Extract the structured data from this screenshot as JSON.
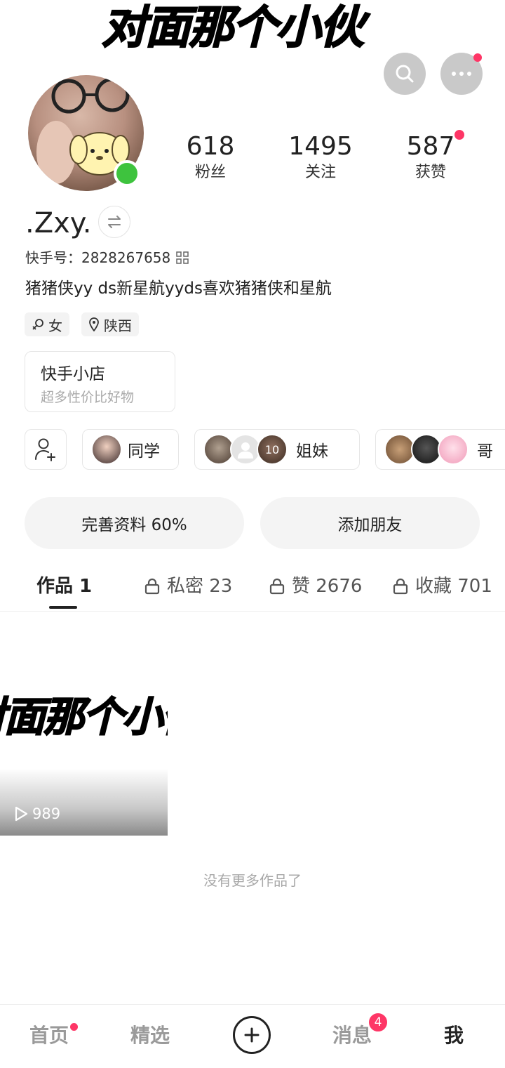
{
  "banner": {
    "title": "对面那个小伙"
  },
  "stats": [
    {
      "value": "618",
      "label": "粉丝"
    },
    {
      "value": "1495",
      "label": "关注"
    },
    {
      "value": "587",
      "label": "获赞"
    }
  ],
  "profile": {
    "username": ".Zxy.",
    "kuaishou_id": "快手号：2828267658",
    "bio": "猪猪侠yy ds新星航yyds喜欢猪猪侠和星航",
    "tags": {
      "gender": "女",
      "location": "陕西"
    }
  },
  "shop": {
    "title": "快手小店",
    "subtitle": "超多性价比好物"
  },
  "groups": [
    {
      "label": "同学"
    },
    {
      "label": "姐妹",
      "count": "10"
    },
    {
      "label": "哥"
    }
  ],
  "actions": {
    "complete_profile": "完善资料 60%",
    "add_friend": "添加朋友"
  },
  "tabs": [
    {
      "label": "作品 1"
    },
    {
      "label": "私密 23"
    },
    {
      "label": "赞 2676"
    },
    {
      "label": "收藏 701"
    }
  ],
  "work": {
    "title": "对面那个小伙",
    "plays": "989"
  },
  "footer_note": "没有更多作品了",
  "nav": {
    "home": "首页",
    "featured": "精选",
    "messages": "消息",
    "messages_badge": "4",
    "me": "我"
  },
  "colors": {
    "accent": "#fe3666",
    "online": "#3ec33e"
  }
}
